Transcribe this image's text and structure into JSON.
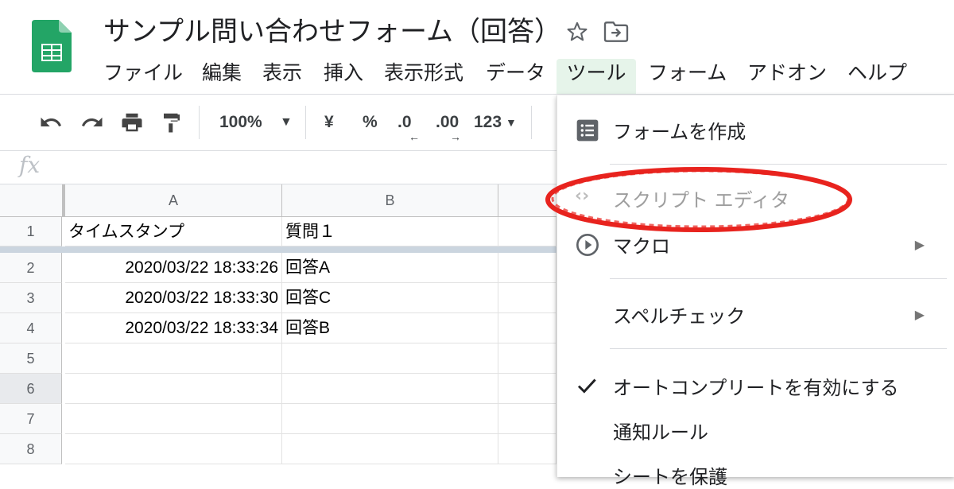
{
  "header": {
    "title": "サンプル問い合わせフォーム（回答）",
    "menu": [
      "ファイル",
      "編集",
      "表示",
      "挿入",
      "表示形式",
      "データ",
      "ツール",
      "フォーム",
      "アドオン",
      "ヘルプ"
    ]
  },
  "toolbar": {
    "zoom": "100%",
    "currency": "¥",
    "percent": "%",
    "decrease_decimal": ".0",
    "increase_decimal": ".00",
    "number_format": "123"
  },
  "formula_bar": {
    "fx": "fx"
  },
  "grid": {
    "columns": [
      "A",
      "B"
    ],
    "rows": [
      {
        "num": "1",
        "a": "タイムスタンプ",
        "b": "質問１"
      },
      {
        "num": "2",
        "a": "2020/03/22 18:33:26",
        "b": "回答A"
      },
      {
        "num": "3",
        "a": "2020/03/22 18:33:30",
        "b": "回答C"
      },
      {
        "num": "4",
        "a": "2020/03/22 18:33:34",
        "b": "回答B"
      },
      {
        "num": "5",
        "a": "",
        "b": ""
      },
      {
        "num": "6",
        "a": "",
        "b": ""
      },
      {
        "num": "7",
        "a": "",
        "b": ""
      },
      {
        "num": "8",
        "a": "",
        "b": ""
      }
    ]
  },
  "tools_menu": {
    "items": [
      "フォームを作成",
      "スクリプト エディタ",
      "マクロ",
      "スペルチェック",
      "オートコンプリートを有効にする",
      "通知ルール",
      "シートを保護"
    ],
    "checked_item": "オートコンプリートを有効にする",
    "disabled_item": "スクリプト エディタ",
    "highlight_color": "#e8231e"
  },
  "colors": {
    "sheets_green": "#23a566",
    "menu_active_bg": "#e6f4ea"
  }
}
